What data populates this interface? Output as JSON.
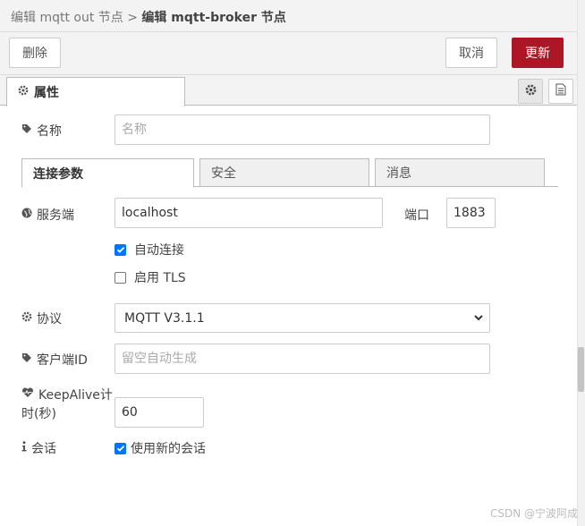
{
  "header": {
    "crumb_parent": "编辑 mqtt out 节点",
    "crumb_sep": ">",
    "crumb_current": "编辑 mqtt-broker 节点"
  },
  "toolbar": {
    "delete_label": "删除",
    "cancel_label": "取消",
    "update_label": "更新"
  },
  "tabs": {
    "properties_label": "属性"
  },
  "form": {
    "name": {
      "label": "名称",
      "placeholder": "名称",
      "value": ""
    },
    "subtabs": [
      "连接参数",
      "安全",
      "消息"
    ],
    "server": {
      "label": "服务端",
      "value": "localhost"
    },
    "port": {
      "label": "端口",
      "value": "1883"
    },
    "auto_connect": {
      "label": "自动连接",
      "checked": true
    },
    "tls": {
      "label": "启用 TLS",
      "checked": false
    },
    "protocol": {
      "label": "协议",
      "selected": "MQTT V3.1.1"
    },
    "client_id": {
      "label": "客户端ID",
      "placeholder": "留空自动生成"
    },
    "keepalive": {
      "label_line1": "KeepAlive计",
      "label_line2": "时(秒)",
      "value": "60"
    },
    "session": {
      "label": "会话",
      "checkbox_label": "使用新的会话",
      "checked": true
    }
  },
  "watermark": "CSDN @宁波阿成",
  "colors": {
    "primary": "#ad1625",
    "checkbox": "#0075ff"
  }
}
